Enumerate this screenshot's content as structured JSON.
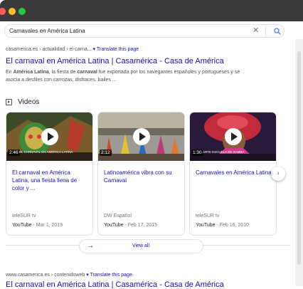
{
  "search": {
    "query": "Carnavales en América Latina",
    "clear_icon": "close-icon",
    "search_icon": "magnifier-icon"
  },
  "result1": {
    "breadcrumb": "casamerica.es › actualidad › el-carna...",
    "translate": "▾ Translate this page",
    "title": "El carnaval en América Latina | Casamérica - Casa de América",
    "snippet_pre": "En ",
    "snippet_bold1": "América Latina",
    "snippet_mid": ", la fiesta de ",
    "snippet_bold2": "carnaval",
    "snippet_post": " fue exportada por los navegantes españoles y portugueses y se asocia a desfiles con carrozas, disfraces, bailes ..."
  },
  "videos": {
    "heading": "Videos",
    "items": [
      {
        "duration": "2:46",
        "caption": "EL CARNAVAL EN AMÉRICA LATINA",
        "title": "El carnaval en América Latina, una fiesta llena de color y ...",
        "source": "teleSUR tv",
        "platform": "YouTube",
        "date": " - Mar 1, 2019"
      },
      {
        "duration": "2:12",
        "caption": "",
        "title": "Latinoamérica vibra con su Carnaval",
        "source": "DW Español",
        "platform": "YouTube",
        "date": " - Feb 17, 2015"
      },
      {
        "duration": "1:30",
        "caption": "ARTE ESCUELA DE SAMBA",
        "title": "Carnavales en América Latina",
        "source": "teleSUR tv",
        "platform": "YouTube",
        "date": " - Feb 16, 2010"
      }
    ],
    "next_icon": "chevron-right-icon",
    "view_all": "View all"
  },
  "result2": {
    "breadcrumb": "www.casamerica.es › contenidoweb",
    "translate": "▾ Translate this page",
    "title": "El carnaval en América Latina | Casamérica - Casa de América"
  },
  "colors": {
    "link": "#1a0dab",
    "text": "#4d5156",
    "border": "#dfe1e5",
    "titlebar": "#3a3a3c"
  }
}
